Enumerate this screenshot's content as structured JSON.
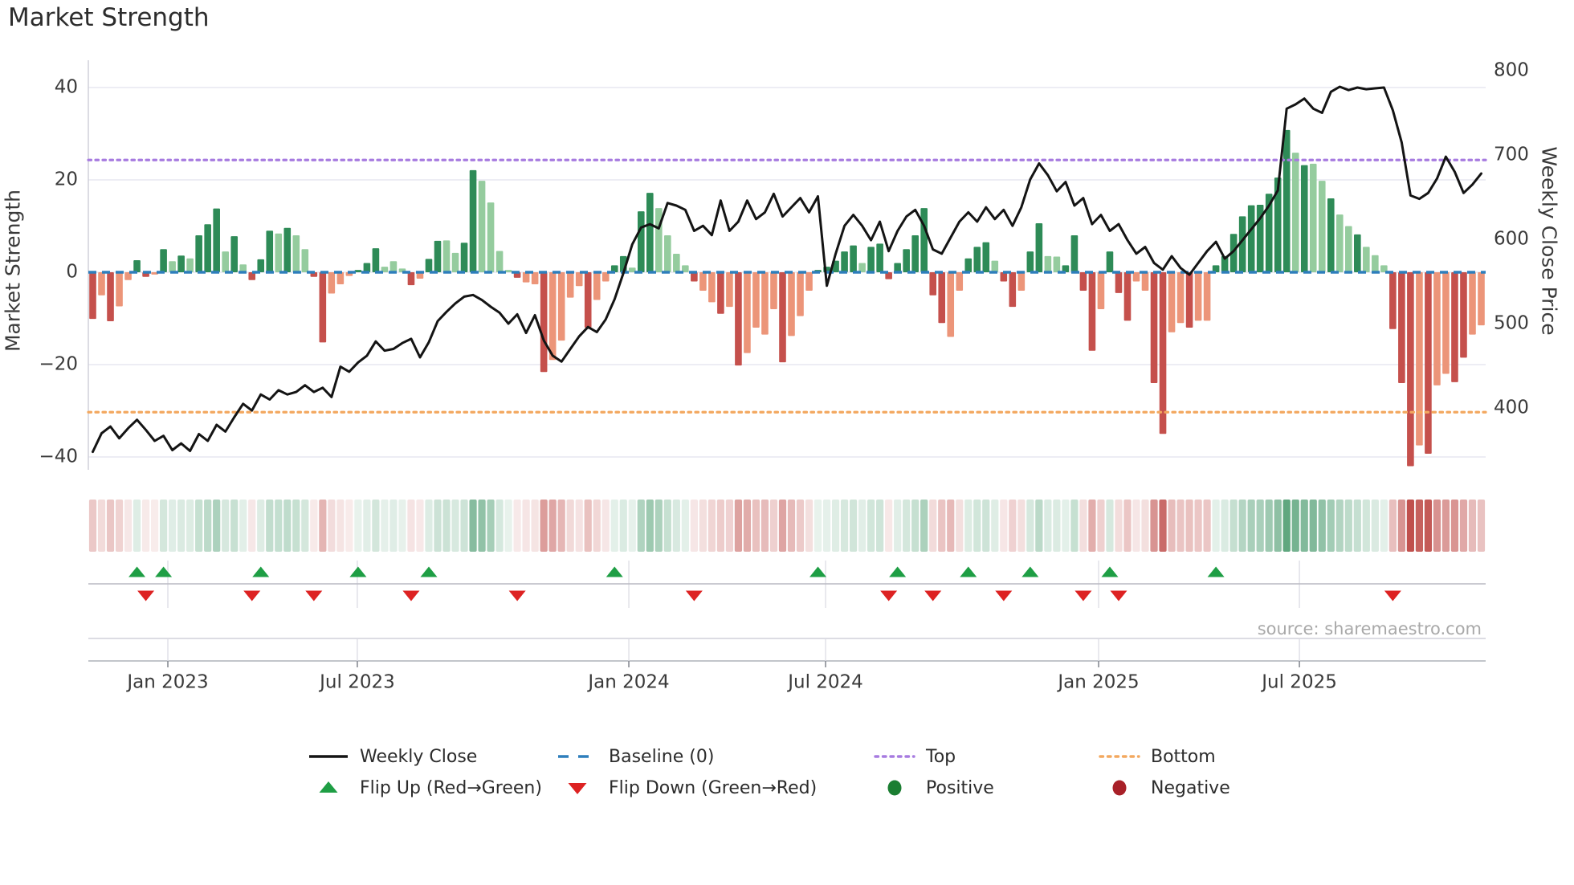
{
  "title": "Market Strength",
  "source": "source: sharemaestro.com",
  "axes": {
    "left_label": "Market Strength",
    "right_label": "Weekly Close Price",
    "left_ticks": [
      "40",
      "20",
      "0",
      "−20",
      "−40"
    ],
    "left_tick_values": [
      40,
      20,
      0,
      -20,
      -40
    ],
    "right_ticks": [
      "800",
      "700",
      "600",
      "500",
      "400"
    ],
    "right_tick_values": [
      800,
      700,
      600,
      500,
      400
    ],
    "x_ticks": [
      {
        "label": "Jan 2023",
        "f": 0.0569
      },
      {
        "label": "Jul 2023",
        "f": 0.1925
      },
      {
        "label": "Jan 2024",
        "f": 0.3868
      },
      {
        "label": "Jul 2024",
        "f": 0.5276
      },
      {
        "label": "Jan 2025",
        "f": 0.723
      },
      {
        "label": "Jul 2025",
        "f": 0.8667
      }
    ]
  },
  "legend": {
    "items": [
      {
        "id": "weekly-close",
        "swatch": "line-black",
        "label": "Weekly Close"
      },
      {
        "id": "baseline",
        "swatch": "dash-blue",
        "label": "Baseline (0)"
      },
      {
        "id": "top",
        "swatch": "dot-purple",
        "label": "Top"
      },
      {
        "id": "bottom",
        "swatch": "dot-orange",
        "label": "Bottom"
      },
      {
        "id": "flip-up",
        "swatch": "tri-up",
        "label": "Flip Up (Red→Green)"
      },
      {
        "id": "flip-down",
        "swatch": "tri-down",
        "label": "Flip Down (Green→Red)"
      },
      {
        "id": "positive",
        "swatch": "circle-green",
        "label": "Positive"
      },
      {
        "id": "negative",
        "swatch": "circle-red",
        "label": "Negative"
      }
    ]
  },
  "colors": {
    "bar_dark_green": "#2e8b57",
    "bar_light_green": "#95cc9e",
    "bar_dark_red": "#c5504c",
    "bar_light_red": "#ec9579",
    "price_line": "#141414",
    "baseline": "#2e7ebc",
    "top_line": "#a77be0",
    "bottom_line": "#f3a85f",
    "flip_up": "#1e9e44",
    "flip_down": "#dd2222",
    "positive_dot": "#1b7e32",
    "negative_dot": "#a82028",
    "heat_green_base": "#2e8b57",
    "heat_red_base": "#c0504d",
    "gridline": "#e7e7f0",
    "spine": "#d0d0da",
    "axis_line": "#aeb2ba",
    "marker_midline": "#b9b9c2",
    "vertical_grid": "#dcdce4",
    "tick_text": "#3a3a3a"
  },
  "chart_data": {
    "type": "combo",
    "subtype": "weekly market-strength bars + price line + heatmap strip + flip markers",
    "weeks": 158,
    "baseline": 0,
    "top_line": 24.3,
    "bottom_line": -30.3,
    "y_left_range": [
      -45.9,
      45.9
    ],
    "y_right_range": [
      327,
      806
    ],
    "legend_position": "bottom",
    "bars": {
      "name": "Market Strength",
      "values": [
        -10.1,
        -5,
        -10.6,
        -7.4,
        -1.7,
        2.6,
        -1,
        -0.5,
        5,
        2.4,
        3.6,
        3,
        8,
        10.4,
        13.8,
        4.5,
        7.8,
        1.7,
        -1.7,
        2.8,
        9,
        8.4,
        9.6,
        8,
        5,
        -1,
        -15.2,
        -4.6,
        -2.6,
        -0.8,
        0.5,
        2,
        5.2,
        1.2,
        2.4,
        0.8,
        -2.8,
        -1.4,
        2.9,
        6.8,
        6.9,
        4.2,
        6.4,
        22.1,
        19.8,
        15.1,
        4.6,
        0.5,
        -1.2,
        -2.2,
        -2.6,
        -21.6,
        -19,
        -14.8,
        -5.5,
        -3,
        -12,
        -6,
        -2,
        1.5,
        3.5,
        1,
        13.2,
        17.2,
        13.9,
        8,
        4,
        1.5,
        -2,
        -4,
        -6.5,
        -9,
        -7.5,
        -20.2,
        -17.5,
        -12,
        -13.5,
        -8,
        -19.5,
        -13.8,
        -9.5,
        -4,
        0.5,
        1.2,
        2.5,
        4.5,
        5.8,
        2,
        5.5,
        6.2,
        -1.5,
        2,
        5,
        8,
        13.9,
        -5,
        -11,
        -14,
        -4,
        3,
        5.5,
        6.5,
        2.5,
        -2,
        -7.5,
        -4,
        4.5,
        10.6,
        3.5,
        3.4,
        1.5,
        8,
        -4,
        -17,
        -8,
        4.5,
        -4.5,
        -10.5,
        -2,
        -4,
        -24,
        -35,
        -13,
        -11,
        -12,
        -10.5,
        -10.5,
        1.5,
        3.5,
        8.3,
        12.1,
        14.5,
        14.6,
        17,
        20.5,
        30.8,
        25.9,
        23.2,
        23.5,
        19.8,
        16,
        12.5,
        10,
        8.2,
        5.5,
        3.7,
        1.5,
        -12.3,
        -24,
        -42,
        -37.5,
        -39.3,
        -24.5,
        -22,
        -23.8,
        -18.5,
        -13.5,
        -11.5
      ],
      "shades": [
        "dr",
        "lr",
        "dr",
        "lr",
        "lr",
        "dg",
        "dr",
        "lr",
        "dg",
        "lg",
        "dg",
        "lg",
        "dg",
        "dg",
        "dg",
        "lg",
        "dg",
        "lg",
        "dr",
        "dg",
        "dg",
        "lg",
        "dg",
        "lg",
        "lg",
        "dr",
        "dr",
        "lr",
        "lr",
        "lr",
        "dg",
        "dg",
        "dg",
        "lg",
        "lg",
        "lg",
        "dr",
        "lr",
        "dg",
        "dg",
        "lg",
        "lg",
        "dg",
        "dg",
        "lg",
        "lg",
        "lg",
        "lg",
        "dr",
        "lr",
        "lr",
        "dr",
        "lr",
        "lr",
        "lr",
        "lr",
        "dr",
        "lr",
        "lr",
        "dg",
        "dg",
        "lg",
        "dg",
        "dg",
        "lg",
        "lg",
        "lg",
        "lg",
        "dr",
        "lr",
        "lr",
        "dr",
        "lr",
        "dr",
        "lr",
        "lr",
        "lr",
        "lr",
        "dr",
        "lr",
        "lr",
        "lr",
        "dg",
        "dg",
        "dg",
        "dg",
        "dg",
        "lg",
        "dg",
        "dg",
        "dr",
        "dg",
        "dg",
        "dg",
        "dg",
        "dr",
        "dr",
        "lr",
        "lr",
        "dg",
        "dg",
        "dg",
        "lg",
        "dr",
        "dr",
        "lr",
        "dg",
        "dg",
        "lg",
        "lg",
        "dg",
        "dg",
        "dr",
        "dr",
        "lr",
        "dg",
        "dr",
        "dr",
        "lr",
        "lr",
        "dr",
        "dr",
        "lr",
        "lr",
        "dr",
        "lr",
        "lr",
        "dg",
        "dg",
        "dg",
        "dg",
        "dg",
        "dg",
        "dg",
        "dg",
        "dg",
        "lg",
        "dg",
        "lg",
        "lg",
        "dg",
        "lg",
        "lg",
        "dg",
        "lg",
        "lg",
        "lg",
        "dr",
        "dr",
        "dr",
        "lr",
        "dr",
        "lr",
        "lr",
        "dr",
        "dr",
        "lr",
        "lr"
      ]
    },
    "line": {
      "name": "Weekly Close",
      "values": [
        348,
        370,
        378,
        364,
        376,
        386,
        374,
        361,
        367,
        350,
        358,
        349,
        369,
        361,
        380,
        372,
        389,
        405,
        397,
        416,
        410,
        421,
        416,
        419,
        427,
        419,
        424,
        413,
        449,
        443,
        454,
        462,
        479,
        468,
        470,
        477,
        482,
        460,
        478,
        503,
        514,
        524,
        532,
        534,
        528,
        520,
        513,
        500,
        511,
        489,
        510,
        480,
        462,
        455,
        470,
        485,
        496,
        490,
        505,
        529,
        560,
        594,
        614,
        618,
        613,
        643,
        640,
        635,
        610,
        616,
        605,
        646,
        610,
        621,
        646,
        624,
        632,
        654,
        627,
        638,
        649,
        632,
        651,
        545,
        583,
        616,
        629,
        616,
        599,
        621,
        586,
        610,
        627,
        635,
        616,
        588,
        583,
        602,
        621,
        632,
        621,
        638,
        624,
        635,
        616,
        638,
        671,
        690,
        676,
        657,
        668,
        640,
        649,
        618,
        629,
        610,
        618,
        599,
        583,
        591,
        572,
        564,
        580,
        566,
        558,
        572,
        586,
        597,
        577,
        586,
        599,
        612,
        625,
        640,
        658,
        755,
        760,
        767,
        755,
        750,
        775,
        781,
        777,
        780,
        778,
        779,
        780,
        753,
        715,
        652,
        648,
        655,
        672,
        698,
        680,
        655,
        665,
        678
      ]
    },
    "flip_up_weeks": [
      5,
      8,
      19,
      30,
      38,
      59,
      82,
      91,
      99,
      106,
      115,
      127
    ],
    "flip_down_weeks": [
      6,
      18,
      25,
      36,
      48,
      68,
      90,
      95,
      103,
      112,
      116,
      147
    ],
    "heatmap": "strip below main panel; cell color derived from bars.values (green positive, red negative, intensity proportional to magnitude)"
  }
}
